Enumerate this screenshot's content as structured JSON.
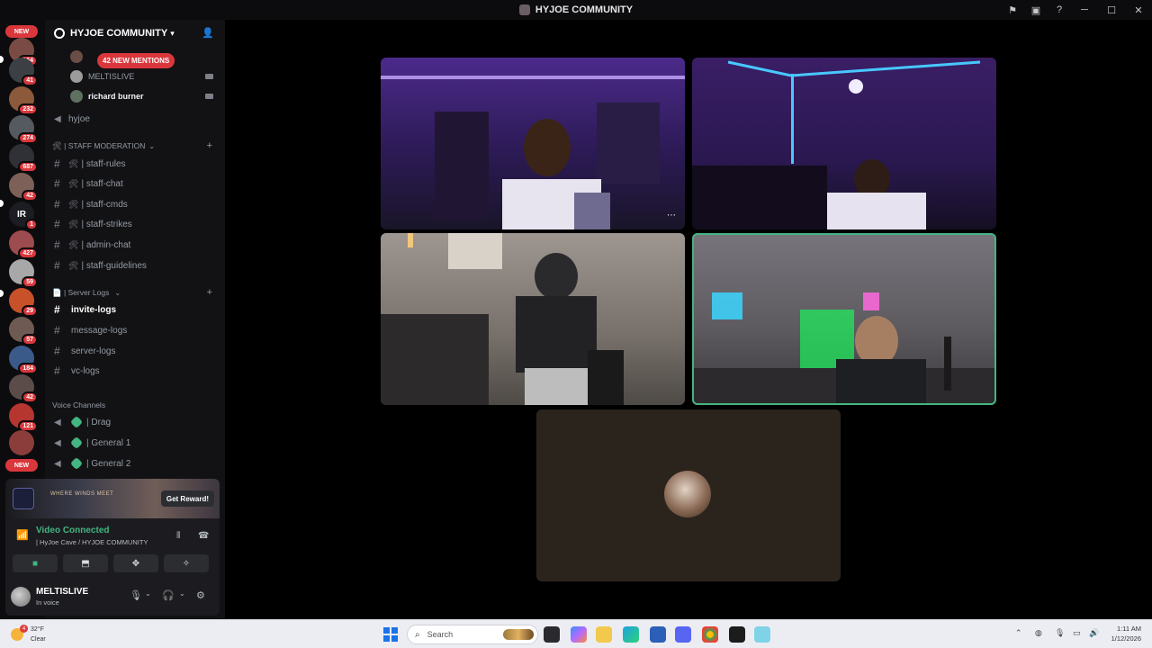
{
  "window": {
    "title": "HYJOE COMMUNITY"
  },
  "rail": {
    "new_top": "NEW",
    "new_bottom": "NEW",
    "badges": [
      "164",
      "41",
      "232",
      "274",
      "687",
      "42",
      "1",
      "427",
      "59",
      "29",
      "57",
      "184",
      "42",
      "121"
    ]
  },
  "guild": {
    "name": "HYJOE COMMUNITY",
    "mentions": "42 NEW MENTIONS"
  },
  "voice_members": [
    "MELTISLIVE",
    "richard burner"
  ],
  "channels_top": [
    {
      "name": "hyjoe"
    }
  ],
  "categories": {
    "staff": "🛠 | STAFF MODERATION",
    "logs": "📄 | Server Logs",
    "voice": "Voice Channels"
  },
  "staff_channels": [
    "| staff-rules",
    "| staff-chat",
    "| staff-cmds",
    "| staff-strikes",
    "| admin-chat",
    "| staff-guidelines"
  ],
  "log_channels": [
    "invite-logs",
    "message-logs",
    "server-logs",
    "vc-logs"
  ],
  "voice_channels": [
    "| Drag",
    "| General 1",
    "| General 2"
  ],
  "promo": {
    "brand": "WHERE WINDS MEET",
    "button": "Get Reward!"
  },
  "voice_status": {
    "title": "Video Connected",
    "location": "| HyJoe Cave / HYJOE COMMUNITY"
  },
  "user": {
    "name": "MELTISLIVE",
    "status": "In voice"
  },
  "taskbar": {
    "temp": "32°F",
    "condition": "Clear",
    "weather_badge": "4",
    "search_placeholder": "Search",
    "time": "1:11 AM",
    "date": "1/12/2026"
  },
  "colors": {
    "accent_green": "#43b581",
    "mention_red": "#da373c",
    "sidebar_bg": "#121214"
  }
}
